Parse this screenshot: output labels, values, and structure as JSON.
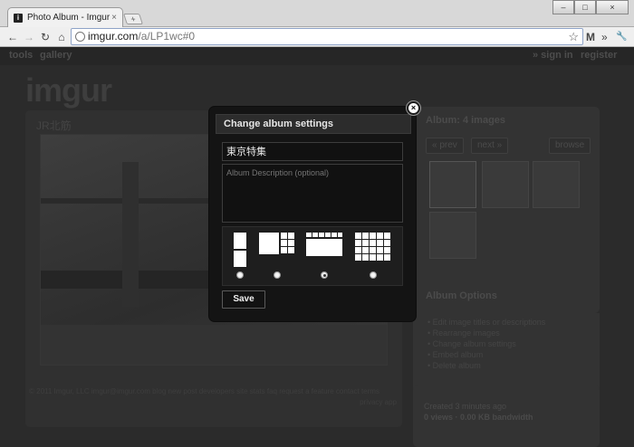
{
  "browser": {
    "tab_title": "Photo Album - Imgur",
    "tab_favicon": "i",
    "tab_close": "×",
    "new_tab": "+",
    "window_minimize": "–",
    "window_maximize": "□",
    "window_close": "×",
    "nav_back": "←",
    "nav_forward": "→",
    "nav_reload": "↻",
    "nav_home": "⌂",
    "url_host": "imgur.com",
    "url_path": "/a/LP1wc#0",
    "bookmark_star": "☆",
    "gmail_icon": "M",
    "more_icon": "»",
    "wrench_icon": "🔧"
  },
  "site": {
    "nav_left": [
      "tools",
      "gallery"
    ],
    "nav_right": [
      "» sign in",
      "register"
    ],
    "logo": "imgur",
    "album_name": "JR北筋",
    "album_heading": "Album: 4 images",
    "prev": "« prev",
    "next": "next »",
    "browse": "browse",
    "options_heading": "Album Options",
    "options": [
      "Edit image titles or descriptions",
      "Rearrange images",
      "Change album settings",
      "Embed album",
      "Delete album"
    ],
    "created": "Created 3 minutes ago",
    "stats": "0 views · 0.00 KB bandwidth",
    "footer_links": "© 2011 Imgur, LLC  imgur@imgur.com   blog  new post  developers  site stats  faq  request a feature  contact  terms",
    "footer_links2": "privacy  app"
  },
  "modal": {
    "title": "Change album settings",
    "close": "×",
    "album_title_value": "東京特集",
    "description_placeholder": "Album Description (optional)",
    "save_label": "Save",
    "layouts": [
      {
        "name": "vertical",
        "selected": false
      },
      {
        "name": "blog",
        "selected": false
      },
      {
        "name": "horizontal",
        "selected": true
      },
      {
        "name": "grid",
        "selected": false
      }
    ]
  }
}
